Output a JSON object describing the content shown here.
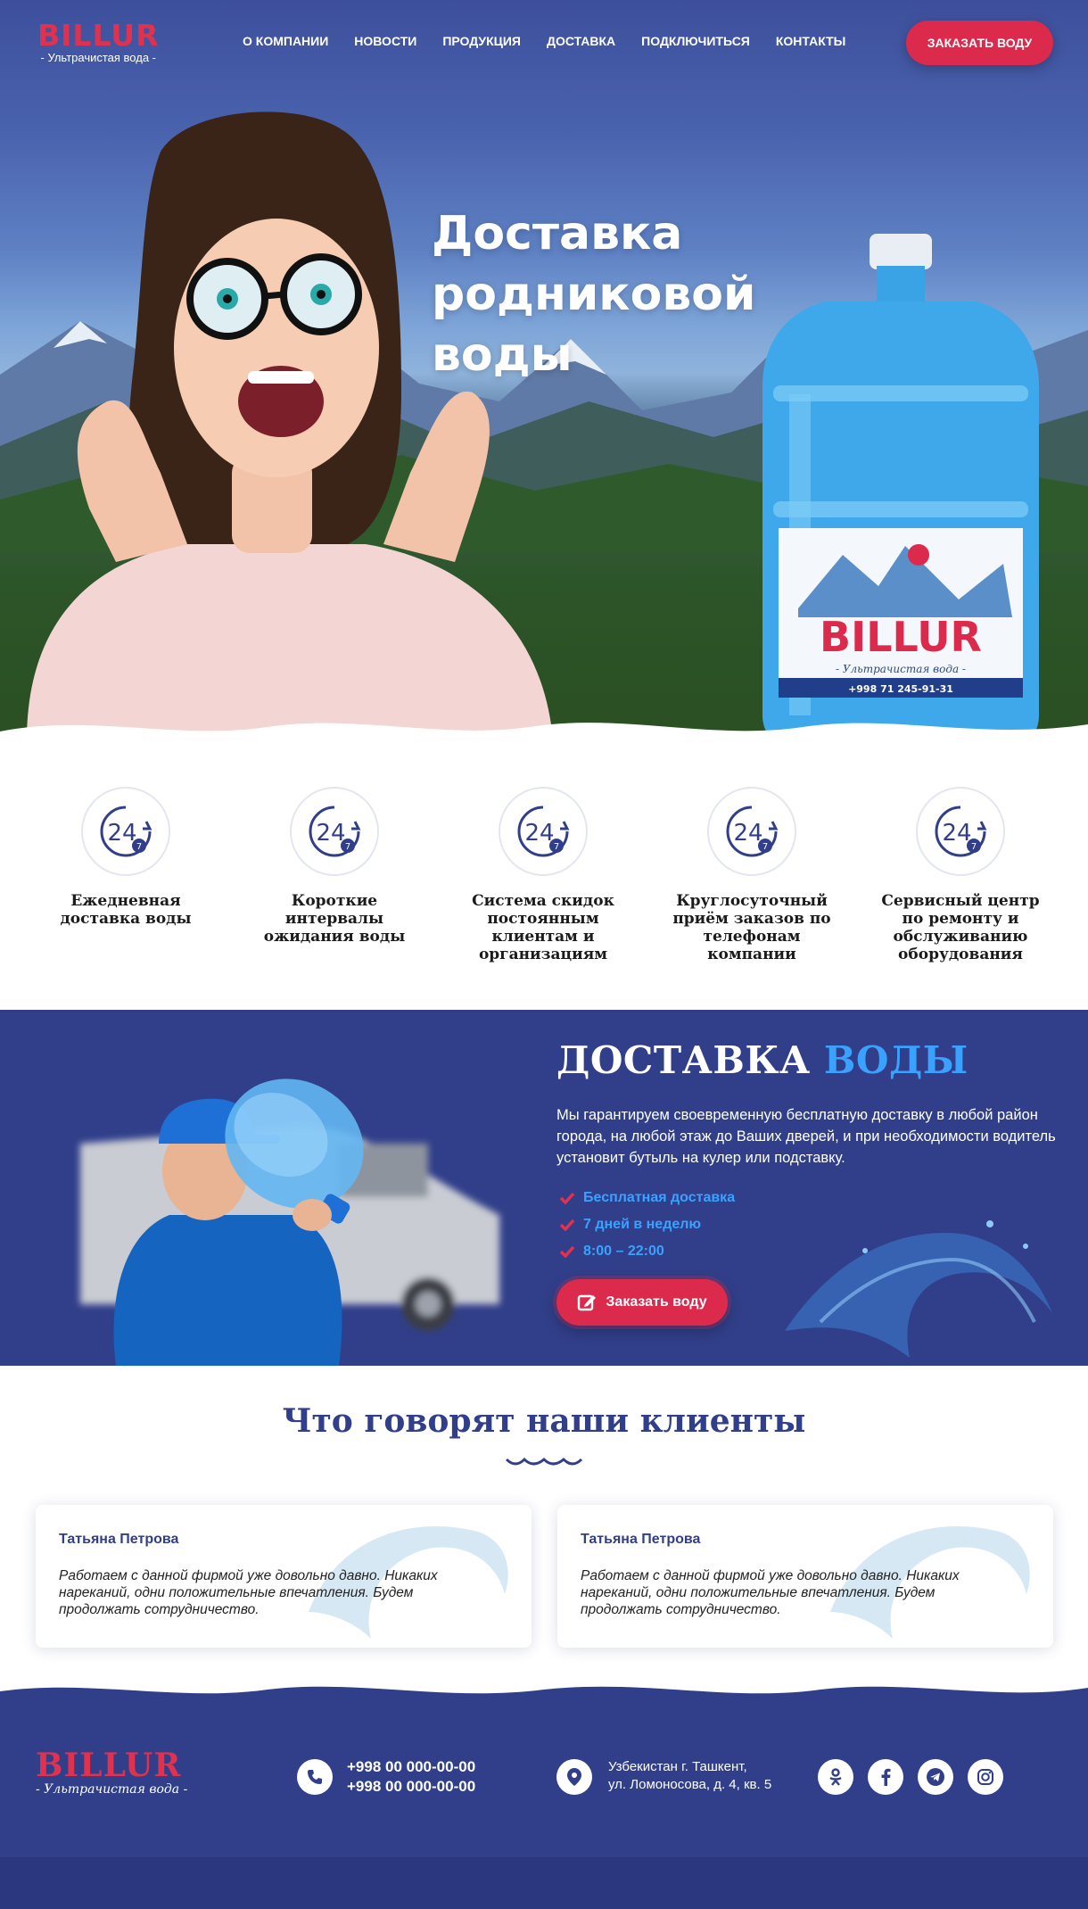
{
  "header": {
    "logo_title": "BILLUR",
    "logo_sub": "- Ультрачистая вода -",
    "nav": [
      "О КОМПАНИИ",
      "НОВОСТИ",
      "ПРОДУКЦИЯ",
      "ДОСТАВКА",
      "ПОДКЛЮЧИТЬСЯ",
      "КОНТАКТЫ"
    ],
    "order_button": "ЗАКАЗАТЬ ВОДУ"
  },
  "hero": {
    "title_line1": "Доставка",
    "title_line2": "родниковой воды",
    "bottle_brand": "BILLUR",
    "bottle_sub": "- Ультрачистая вода -",
    "bottle_phone": "+998 71 245-91-31"
  },
  "features": {
    "icon_label": "24",
    "items": [
      "Ежедневная доставка воды",
      "Короткие интервалы ожидания воды",
      "Система скидок постоянным клиентам и организациям",
      "Круглосуточный приём заказов по телефонам компании",
      "Сервисный центр по ремонту и обслуживанию оборудования"
    ]
  },
  "delivery": {
    "title_main": "ДОСТАВКА",
    "title_accent": "ВОДЫ",
    "description": "Мы гарантируем своевременную бесплатную доставку в любой район города, на любой этаж до Ваших дверей, и при необходимости водитель установит бутыль на кулер или подставку.",
    "checks": [
      "Бесплатная доставка",
      "7 дней в неделю",
      "8:00 – 22:00"
    ],
    "button": "Заказать воду"
  },
  "reviews": {
    "title": "Что говорят наши клиенты",
    "items": [
      {
        "name": "Татьяна Петрова",
        "text": "Работаем с данной фирмой уже довольно давно. Никаких нареканий, одни положительные впечатления. Будем продолжать сотрудничество."
      },
      {
        "name": "Татьяна Петрова",
        "text": "Работаем с данной фирмой уже довольно давно. Никаких нареканий, одни положительные впечатления. Будем продолжать сотрудничество."
      }
    ]
  },
  "footer": {
    "logo_title": "BILLUR",
    "logo_sub": "- Ультрачистая вода -",
    "phone1": "+998 00 000-00-00",
    "phone2": "+998 00 000-00-00",
    "address_line1": "Узбекистан г. Ташкент,",
    "address_line2": "ул. Ломоносова, д. 4, кв. 5",
    "social": [
      "odnoklassniki-icon",
      "facebook-icon",
      "telegram-icon",
      "instagram-icon"
    ]
  },
  "colors": {
    "brand_blue": "#313f8a",
    "accent_red": "#dc2a4c",
    "accent_blue": "#3ba1ff"
  }
}
